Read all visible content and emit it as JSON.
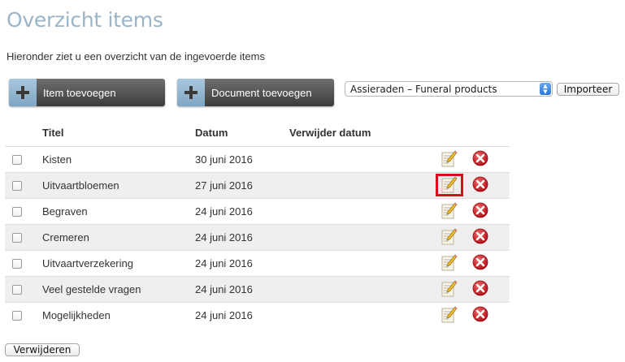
{
  "page": {
    "title": "Overzicht items",
    "intro": "Hieronder ziet u een overzicht van de ingevoerde items"
  },
  "toolbar": {
    "add_item_label": "Item toevoegen",
    "add_document_label": "Document toevoegen",
    "select_value": "Assieraden – Funeral products",
    "import_label": "Importeer"
  },
  "table": {
    "headers": {
      "title": "Titel",
      "date": "Datum",
      "delete_date": "Verwijder datum"
    },
    "rows": [
      {
        "title": "Kisten",
        "date": "30 juni 2016",
        "delete_date": ""
      },
      {
        "title": "Uitvaartbloemen",
        "date": "27 juni 2016",
        "delete_date": ""
      },
      {
        "title": "Begraven",
        "date": "24 juni 2016",
        "delete_date": ""
      },
      {
        "title": "Cremeren",
        "date": "24 juni 2016",
        "delete_date": ""
      },
      {
        "title": "Uitvaartverzekering",
        "date": "24 juni 2016",
        "delete_date": ""
      },
      {
        "title": "Veel gestelde vragen",
        "date": "24 juni 2016",
        "delete_date": ""
      },
      {
        "title": "Mogelijkheden",
        "date": "24 juni 2016",
        "delete_date": ""
      }
    ],
    "highlighted_row": 1
  },
  "footer": {
    "delete_label": "Verwijderen"
  },
  "icons": {
    "plus": "plus-icon",
    "edit": "edit-pencil-icon",
    "remove": "remove-x-icon"
  },
  "colors": {
    "title": "#9ab4c8",
    "plus_tile": "#8fb3cf",
    "button_dark": "#4a4a4a",
    "remove_red": "#d21c25",
    "highlight": "#d6101b",
    "row_alt": "#efefef"
  }
}
